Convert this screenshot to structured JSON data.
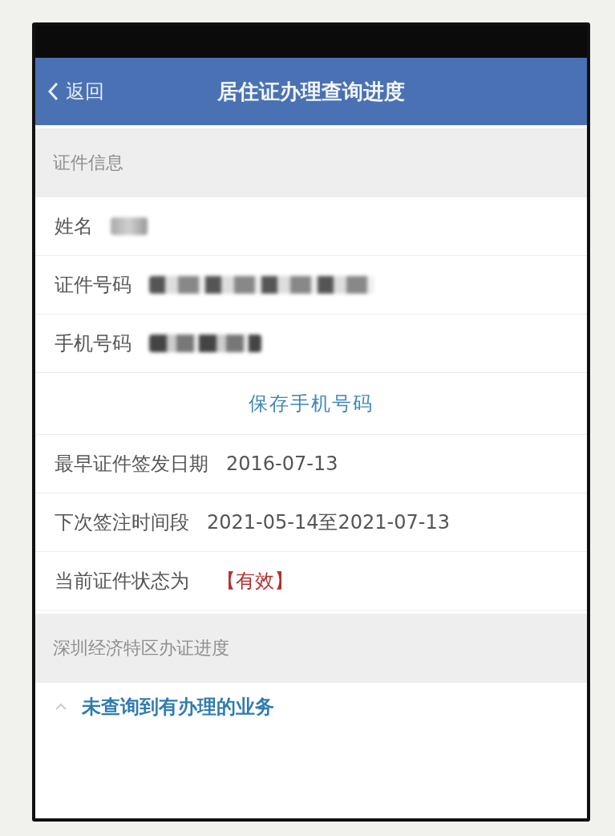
{
  "nav_bar": {
    "back": "返回",
    "title": "居住证办理查询进度"
  },
  "sections": [
    {
      "title": "证件信息",
      "rows": [
        {
          "kind": "redacted",
          "label": "姓名"
        },
        {
          "kind": "redacted",
          "label": "证件号码"
        },
        {
          "kind": "redacted",
          "label": "手机号码"
        },
        {
          "kind": "button",
          "label": "保存手机号码"
        },
        {
          "kind": "text",
          "label": "最早证件签发日期",
          "value": "2016-07-13"
        },
        {
          "kind": "text",
          "label": "下次签注时间段",
          "value": "2021-05-14至2021-07-13"
        },
        {
          "kind": "status",
          "label": "当前证件状态为",
          "value": "【有效】"
        }
      ]
    },
    {
      "title": "深圳经济特区办证进度",
      "rows": [
        {
          "kind": "expander",
          "label": "未查询到有办理的业务",
          "expanded": true
        }
      ]
    }
  ]
}
